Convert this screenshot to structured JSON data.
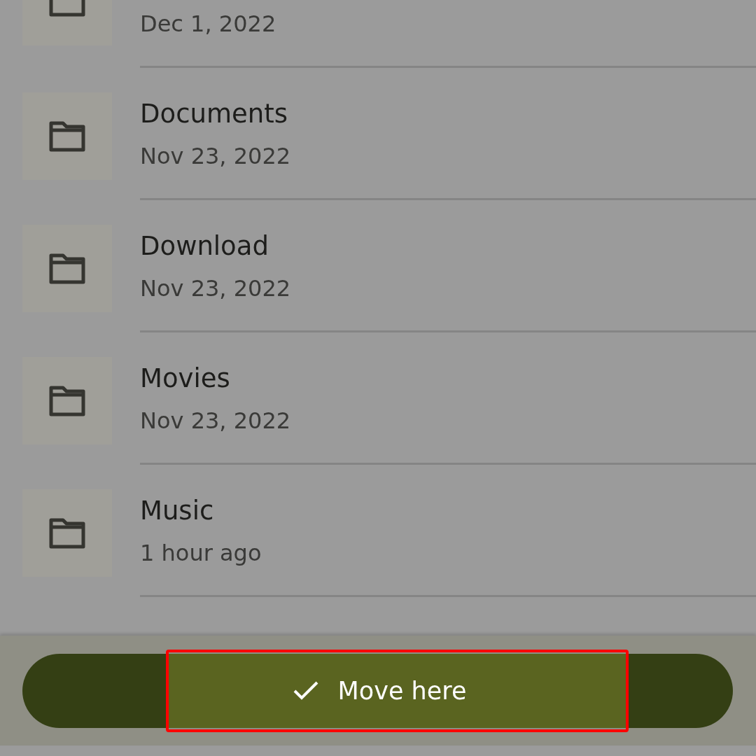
{
  "folders": [
    {
      "date": "Dec 1, 2022"
    },
    {
      "name": "Documents",
      "date": "Nov 23, 2022"
    },
    {
      "name": "Download",
      "date": "Nov 23, 2022"
    },
    {
      "name": "Movies",
      "date": "Nov 23, 2022"
    },
    {
      "name": "Music",
      "date": "1 hour ago"
    }
  ],
  "action_button": {
    "label": "Move here",
    "highlighted": true
  }
}
